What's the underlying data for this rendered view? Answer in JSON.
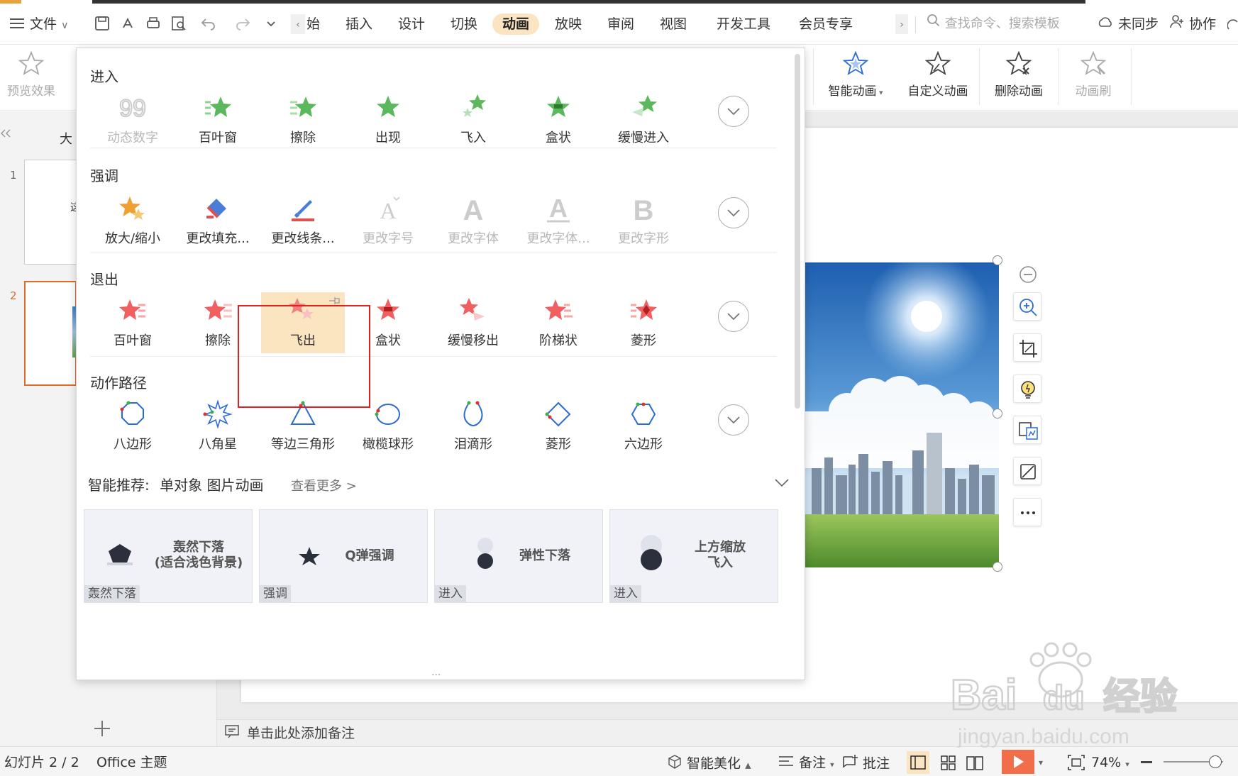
{
  "menubar": {
    "file": "文件",
    "partial_tab": "始",
    "tabs": [
      "插入",
      "设计",
      "切换",
      "动画",
      "放映",
      "审阅",
      "视图",
      "开发工具",
      "会员专享"
    ],
    "active_tab": "动画",
    "search_placeholder": "查找命令、搜索模板",
    "sync": "未同步",
    "collab": "协作"
  },
  "ribbon": {
    "preview": "预览效果",
    "smart_anim": "智能动画",
    "custom_anim": "自定义动画",
    "delete_anim": "删除动画",
    "anim_brush": "动画刷"
  },
  "leftpane": {
    "tab_partial": "大",
    "slide_numbers": [
      "1",
      "2"
    ],
    "thumb1_text": "这"
  },
  "anim_panel": {
    "sections": [
      {
        "title": "进入",
        "effects": [
          {
            "label": "动态数字",
            "icon": "dynamic-number-icon",
            "disabled": true
          },
          {
            "label": "百叶窗",
            "icon": "blinds-star-icon"
          },
          {
            "label": "擦除",
            "icon": "wipe-star-icon"
          },
          {
            "label": "出现",
            "icon": "appear-star-icon"
          },
          {
            "label": "飞入",
            "icon": "fly-in-star-icon"
          },
          {
            "label": "盒状",
            "icon": "box-star-icon"
          },
          {
            "label": "缓慢进入",
            "icon": "crawl-in-star-icon"
          }
        ]
      },
      {
        "title": "强调",
        "effects": [
          {
            "label": "放大/缩小",
            "icon": "grow-shrink-star-icon"
          },
          {
            "label": "更改填充...",
            "icon": "fill-bucket-icon"
          },
          {
            "label": "更改线条...",
            "icon": "line-brush-icon"
          },
          {
            "label": "更改字号",
            "icon": "font-size-icon",
            "disabled": true
          },
          {
            "label": "更改字体",
            "icon": "font-icon",
            "disabled": true
          },
          {
            "label": "更改字体...",
            "icon": "font-color-icon",
            "disabled": true
          },
          {
            "label": "更改字形",
            "icon": "font-style-icon",
            "disabled": true
          }
        ]
      },
      {
        "title": "退出",
        "effects": [
          {
            "label": "百叶窗",
            "icon": "blinds-exit-star-icon"
          },
          {
            "label": "擦除",
            "icon": "wipe-exit-star-icon"
          },
          {
            "label": "飞出",
            "icon": "fly-out-star-icon",
            "selected": true
          },
          {
            "label": "盒状",
            "icon": "box-exit-star-icon"
          },
          {
            "label": "缓慢移出",
            "icon": "crawl-out-star-icon"
          },
          {
            "label": "阶梯状",
            "icon": "stairs-exit-star-icon"
          },
          {
            "label": "菱形",
            "icon": "diamond-exit-star-icon"
          }
        ]
      },
      {
        "title": "动作路径",
        "effects": [
          {
            "label": "八边形",
            "icon": "octagon-path-icon"
          },
          {
            "label": "八角星",
            "icon": "eight-point-star-path-icon"
          },
          {
            "label": "等边三角形",
            "icon": "triangle-path-icon"
          },
          {
            "label": "橄榄球形",
            "icon": "football-path-icon"
          },
          {
            "label": "泪滴形",
            "icon": "teardrop-path-icon"
          },
          {
            "label": "菱形",
            "icon": "diamond-path-icon"
          },
          {
            "label": "六边形",
            "icon": "hexagon-path-icon"
          }
        ]
      }
    ],
    "smart_rec_label": "智能推荐:",
    "smart_rec_target": "单对象 图片动画",
    "see_more": "查看更多 >",
    "cards": [
      {
        "title": "轰然下落\n(适合浅色背景)",
        "tag": "轰然下落"
      },
      {
        "title": "Q弹强调",
        "tag": "强调"
      },
      {
        "title": "弹性下落",
        "tag": "进入"
      },
      {
        "title": "上方缩放\n飞入",
        "tag": "进入"
      }
    ],
    "bottom_dots": "..."
  },
  "notes": {
    "placeholder": "单击此处添加备注"
  },
  "statusbar": {
    "slide_count": "幻灯片 2 / 2",
    "theme": "Office 主题",
    "beautify": "智能美化",
    "notes": "备注",
    "comments": "批注",
    "zoom": "74%"
  },
  "watermark": {
    "brand": "Bai du 经验",
    "url": "jingyan.baidu.com"
  }
}
